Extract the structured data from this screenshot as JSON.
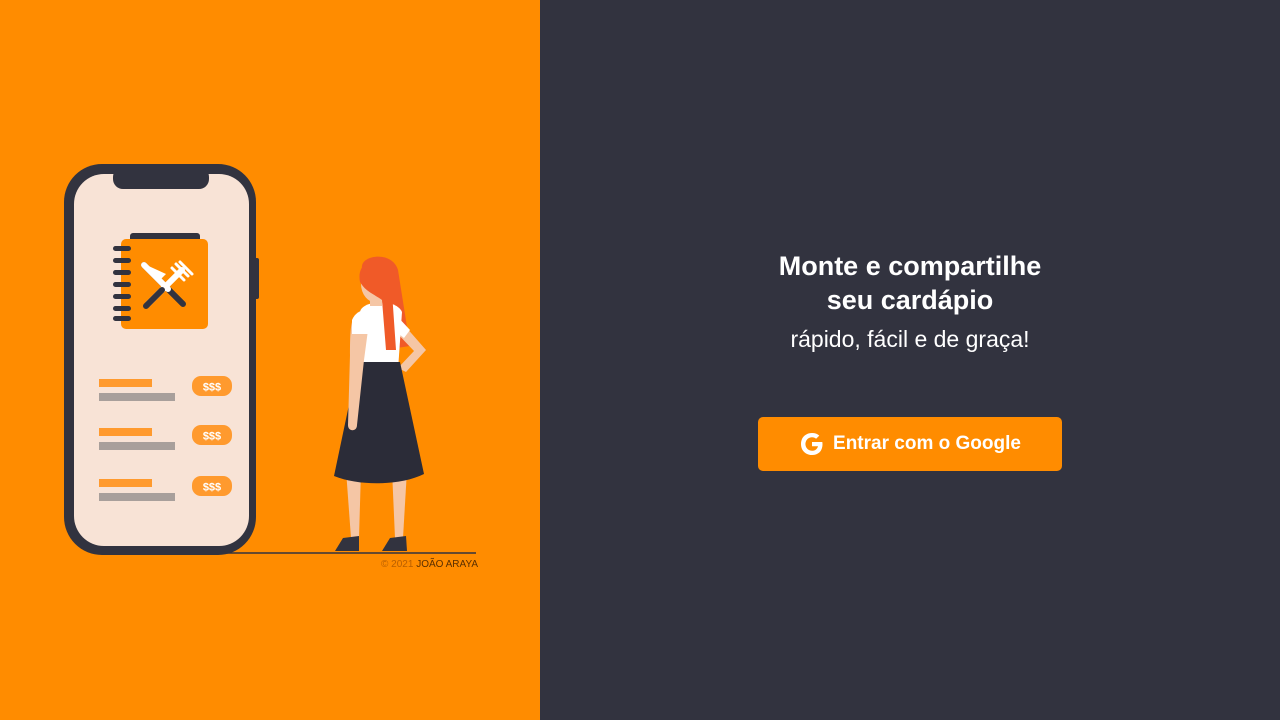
{
  "illustration": {
    "price_tag": "$$$",
    "credit_prefix": "© 2021",
    "credit_author": "JOÃO ARAYA"
  },
  "hero": {
    "headline_line1": "Monte e compartilhe",
    "headline_line2": "seu cardápio",
    "subheadline": "rápido, fácil e de graça!"
  },
  "login": {
    "google_button_label": "Entrar com o Google",
    "icon": "google-icon"
  },
  "colors": {
    "brand_orange": "#ff8c00",
    "dark_background": "#32333f",
    "text": "#ffffff"
  }
}
